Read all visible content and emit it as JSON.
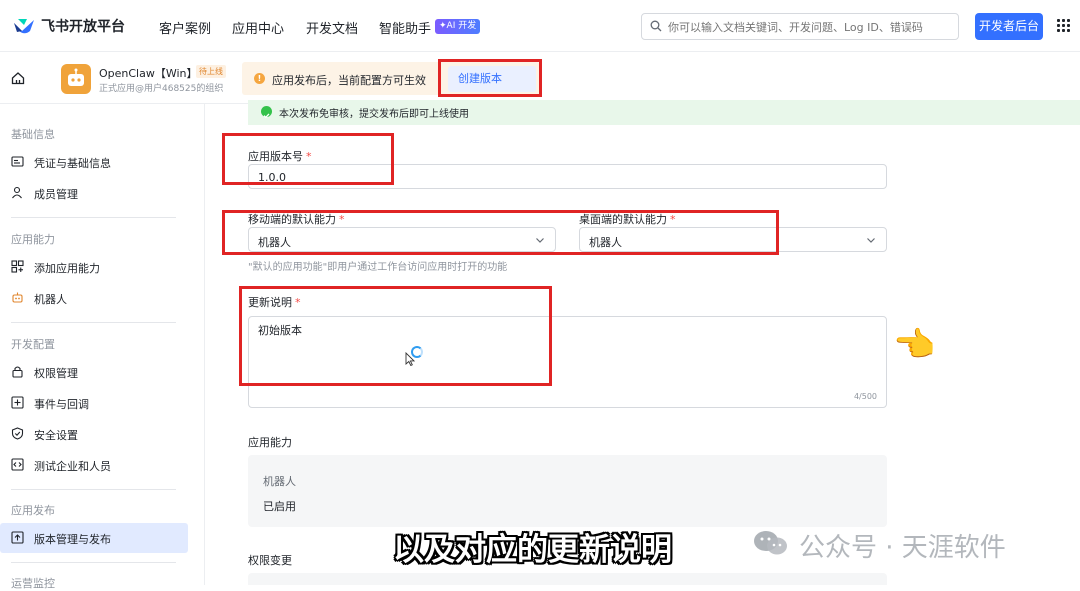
{
  "topnav": {
    "logo_text": "飞书开放平台",
    "items": [
      "客户案例",
      "应用中心",
      "开发文档",
      "智能助手"
    ],
    "ai_badge": "✦AI 开发",
    "search_placeholder": "你可以输入文档关键词、开发问题、Log ID、错误码",
    "dev_button": "开发者后台"
  },
  "app": {
    "name": "OpenClaw【Win】",
    "badge": "待上线",
    "subtitle": "正式应用@用户468525的组织"
  },
  "notice": {
    "text": "应用发布后，当前配置方可生效",
    "button": "创建版本"
  },
  "sidebar": {
    "groups": [
      "基础信息",
      "应用能力",
      "开发配置",
      "应用发布",
      "运营监控"
    ],
    "items": [
      {
        "label": "凭证与基础信息",
        "icon": "id-card-icon"
      },
      {
        "label": "成员管理",
        "icon": "user-icon"
      },
      {
        "label": "添加应用能力",
        "icon": "add-grid-icon"
      },
      {
        "label": "机器人",
        "icon": "robot-icon"
      },
      {
        "label": "权限管理",
        "icon": "lock-icon"
      },
      {
        "label": "事件与回调",
        "icon": "event-icon"
      },
      {
        "label": "安全设置",
        "icon": "shield-icon"
      },
      {
        "label": "测试企业和人员",
        "icon": "code-icon"
      },
      {
        "label": "版本管理与发布",
        "icon": "upload-icon",
        "active": true
      }
    ]
  },
  "form": {
    "success_text": "本次发布免审核，提交发布后即可上线使用",
    "version_label": "应用版本号",
    "version_value": "1.0.0",
    "mobile_label": "移动端的默认能力",
    "mobile_value": "机器人",
    "desktop_label": "桌面端的默认能力",
    "desktop_value": "机器人",
    "hint": "\"默认的应用功能\"即用户通过工作台访问应用时打开的功能",
    "notes_label": "更新说明",
    "notes_value": "初始版本",
    "notes_counter": "4/500",
    "required_mark": "*"
  },
  "capability": {
    "title": "应用能力",
    "name": "机器人",
    "status": "已启用"
  },
  "permission": {
    "title": "权限变更"
  },
  "overlay": {
    "caption": "以及对应的更新说明",
    "watermark": "公众号 · 天涯软件",
    "pointer": "👈"
  },
  "colors": {
    "accent": "#3370ff",
    "annotation_red": "#e02424",
    "success_bg": "#e8f7ea",
    "notice_bg": "#fdf3e6"
  }
}
